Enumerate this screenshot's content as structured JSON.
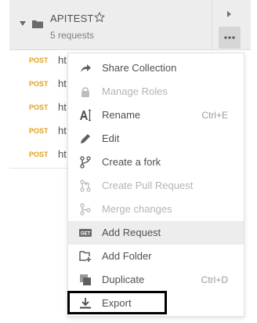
{
  "collection": {
    "name": "APITEST",
    "count_text": "5 requests"
  },
  "requests": [
    {
      "method": "POST",
      "name": "ht"
    },
    {
      "method": "POST",
      "name": "ht"
    },
    {
      "method": "POST",
      "name": "ht"
    },
    {
      "method": "POST",
      "name": "ht"
    },
    {
      "method": "POST",
      "name": "ht"
    }
  ],
  "menu": {
    "items": [
      {
        "label": "Share Collection",
        "icon": "share-arrow-icon",
        "enabled": true
      },
      {
        "label": "Manage Roles",
        "icon": "lock-icon",
        "enabled": false
      },
      {
        "label": "Rename",
        "shortcut": "Ctrl+E",
        "icon": "rename-cursor-icon",
        "enabled": true
      },
      {
        "label": "Edit",
        "icon": "pencil-icon",
        "enabled": true
      },
      {
        "label": "Create a fork",
        "icon": "fork-icon",
        "enabled": true
      },
      {
        "label": "Create Pull Request",
        "icon": "pull-request-icon",
        "enabled": false
      },
      {
        "label": "Merge changes",
        "icon": "merge-icon",
        "enabled": false
      },
      {
        "label": "Add Request",
        "icon": "get-request-icon",
        "enabled": true,
        "hovered": true
      },
      {
        "label": "Add Folder",
        "icon": "add-folder-icon",
        "enabled": true
      },
      {
        "label": "Duplicate",
        "shortcut": "Ctrl+D",
        "icon": "duplicate-icon",
        "enabled": true
      },
      {
        "label": "Export",
        "icon": "download-icon",
        "enabled": true
      }
    ]
  },
  "colors": {
    "method_post": "#e0a11b",
    "hover_bg": "#ededed",
    "header_bg": "#ededed"
  }
}
